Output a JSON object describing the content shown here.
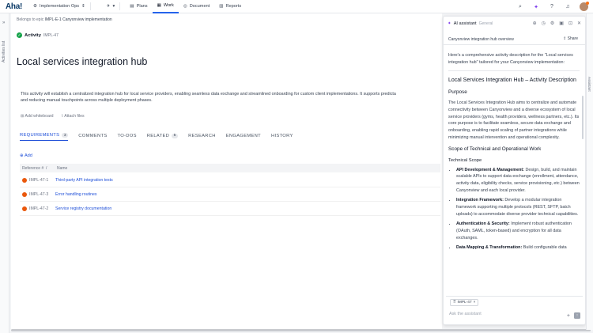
{
  "nav": {
    "logo": "Aha!",
    "workspace": "Implementation Ops",
    "tabs": [
      {
        "label": "Plans"
      },
      {
        "label": "Work"
      },
      {
        "label": "Document"
      },
      {
        "label": "Reports"
      }
    ],
    "active_tab": "Work"
  },
  "rail": {
    "label": "Activities list"
  },
  "record": {
    "belongs_prefix": "Belongs to epic",
    "belongs_epic": "IMPL-E-1 Canyonview implementation",
    "type": "Activity",
    "ref": "IMPL-47",
    "title": "Local services integration hub",
    "description_1": "This activity will establish a centralized integration hub for local service providers, enabling seamless data exchange and streamlined onboarding for custom client implementations. It supports predicta",
    "description_2": "and reducing manual touchpoints across multiple deployment phases.",
    "add_whiteboard": "Add whiteboard",
    "attach_files": "Attach files"
  },
  "tabs": [
    {
      "label": "REQUIREMENTS",
      "count": "3"
    },
    {
      "label": "COMMENTS",
      "count": ""
    },
    {
      "label": "TO-DOS",
      "count": ""
    },
    {
      "label": "RELATED",
      "count": "5"
    },
    {
      "label": "RESEARCH",
      "count": ""
    },
    {
      "label": "ENGAGEMENT",
      "count": ""
    },
    {
      "label": "HISTORY",
      "count": ""
    }
  ],
  "requirements": {
    "add_label": "Add",
    "col_ref": "Reference #",
    "col_sep": "/",
    "col_name": "Name",
    "rows": [
      {
        "ref": "IMPL-47-1",
        "name": "Third-party API integration tests"
      },
      {
        "ref": "IMPL-47-3",
        "name": "Error handling routines"
      },
      {
        "ref": "IMPL-47-2",
        "name": "Service registry documentation"
      }
    ]
  },
  "ai": {
    "title": "AI assistant",
    "context": "General",
    "subtitle": "Canyonview integration hub overview",
    "share": "Share",
    "intro": "Here's a comprehensive activity description for the \"Local services integration hub\" tailored for your Canyonview implementation:",
    "h1": "Local Services Integration Hub – Activity Description",
    "purpose_h": "Purpose",
    "purpose_p": "The Local Services Integration Hub aims to centralize and automate connectivity between Canyonview and a diverse ecosystem of local service providers (gyms, health providers, wellness partners, etc.). Its core purpose is to facilitate seamless, secure data exchange and onboarding, enabling rapid scaling of partner integrations while minimizing manual intervention and operational complexity.",
    "scope_h": "Scope of Technical and Operational Work",
    "tech_h": "Technical Scope",
    "bullets": [
      {
        "b": "API Development & Management:",
        "t": " Design, build, and maintain scalable APIs to support data exchange (enrollment, attendance, activity data, eligibility checks, service provisioning, etc.) between Canyonview and each local provider."
      },
      {
        "b": "Integration Framework:",
        "t": " Develop a modular integration framework supporting multiple protocols (REST, SFTP, batch uploads) to accommodate diverse provider technical capabilities."
      },
      {
        "b": "Authentication & Security:",
        "t": " Implement robust authentication (OAuth, SAML, token-based) and encryption for all data exchanges."
      },
      {
        "b": "Data Mapping & Transformation:",
        "t": " Build configurable data"
      }
    ],
    "chip": "IMPL-47",
    "placeholder": "Ask the assistant"
  },
  "right_rail": {
    "label": "Assistant"
  }
}
